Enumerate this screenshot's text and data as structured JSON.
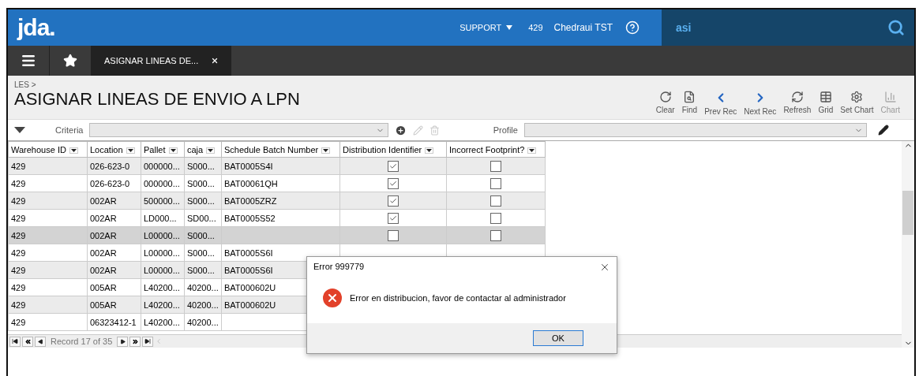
{
  "header": {
    "logo": "jda.",
    "role": "SUPPORT",
    "warehouse": "429",
    "client": "Chedraui TST",
    "search": {
      "value": "asi"
    }
  },
  "tabs": [
    {
      "label": "ASIGNAR LINEAS DE...",
      "selected": true
    }
  ],
  "breadcrumb": "LES >",
  "title": "ASIGNAR LINEAS DE ENVIO A LPN",
  "toolbar": [
    {
      "label": "Clear",
      "kind": "clear",
      "disabled": false
    },
    {
      "label": "Find",
      "kind": "find",
      "disabled": false
    },
    {
      "label": "Prev Rec",
      "kind": "prev",
      "disabled": false
    },
    {
      "label": "Next Rec",
      "kind": "next",
      "disabled": false
    },
    {
      "label": "Refresh",
      "kind": "refresh",
      "disabled": false
    },
    {
      "label": "Grid",
      "kind": "grid",
      "disabled": false
    },
    {
      "label": "Set Chart",
      "kind": "setchart",
      "disabled": false
    },
    {
      "label": "Chart",
      "kind": "chart",
      "disabled": true
    }
  ],
  "criteria": {
    "label": "Criteria"
  },
  "profile": {
    "label": "Profile"
  },
  "table": {
    "columns": [
      "Warehouse ID",
      "Location",
      "Pallet",
      "caja",
      "Schedule Batch Number",
      "Distribution Identifier",
      "Incorrect Footprint?"
    ],
    "rows": [
      {
        "cells": [
          "429",
          "026-623-0",
          "000000...",
          "S000...",
          "BAT0005S4I"
        ],
        "distribution": true,
        "footprint": false,
        "selected": false
      },
      {
        "cells": [
          "429",
          "026-623-0",
          "000000...",
          "S000...",
          "BAT00061QH"
        ],
        "distribution": true,
        "footprint": false,
        "selected": false
      },
      {
        "cells": [
          "429",
          "002AR",
          "500000...",
          "S000...",
          "BAT0005ZRZ"
        ],
        "distribution": true,
        "footprint": false,
        "selected": false
      },
      {
        "cells": [
          "429",
          "002AR",
          "LD000...",
          "SD00...",
          "BAT0005S52"
        ],
        "distribution": true,
        "footprint": false,
        "selected": false
      },
      {
        "cells": [
          "429",
          "002AR",
          "L00000...",
          "S000...",
          ""
        ],
        "distribution": false,
        "footprint": false,
        "selected": true
      },
      {
        "cells": [
          "429",
          "002AR",
          "L00000...",
          "S000...",
          "BAT0005S6I"
        ],
        "selected": false
      },
      {
        "cells": [
          "429",
          "002AR",
          "L00000...",
          "S000...",
          "BAT0005S6I"
        ],
        "selected": false
      },
      {
        "cells": [
          "429",
          "005AR",
          "L40200...",
          "40200...",
          "BAT000602U"
        ],
        "selected": false
      },
      {
        "cells": [
          "429",
          "005AR",
          "L40200...",
          "40200...",
          "BAT000602U"
        ],
        "selected": false
      },
      {
        "cells": [
          "429",
          "06323412-1",
          "L40200...",
          "40200...",
          ""
        ],
        "selected": false
      }
    ]
  },
  "pager": {
    "record": "Record 17 of 35"
  },
  "dialog": {
    "title": "Error 999779",
    "message": "Error en distribucion, favor de contactar al administrador",
    "button": "OK"
  }
}
